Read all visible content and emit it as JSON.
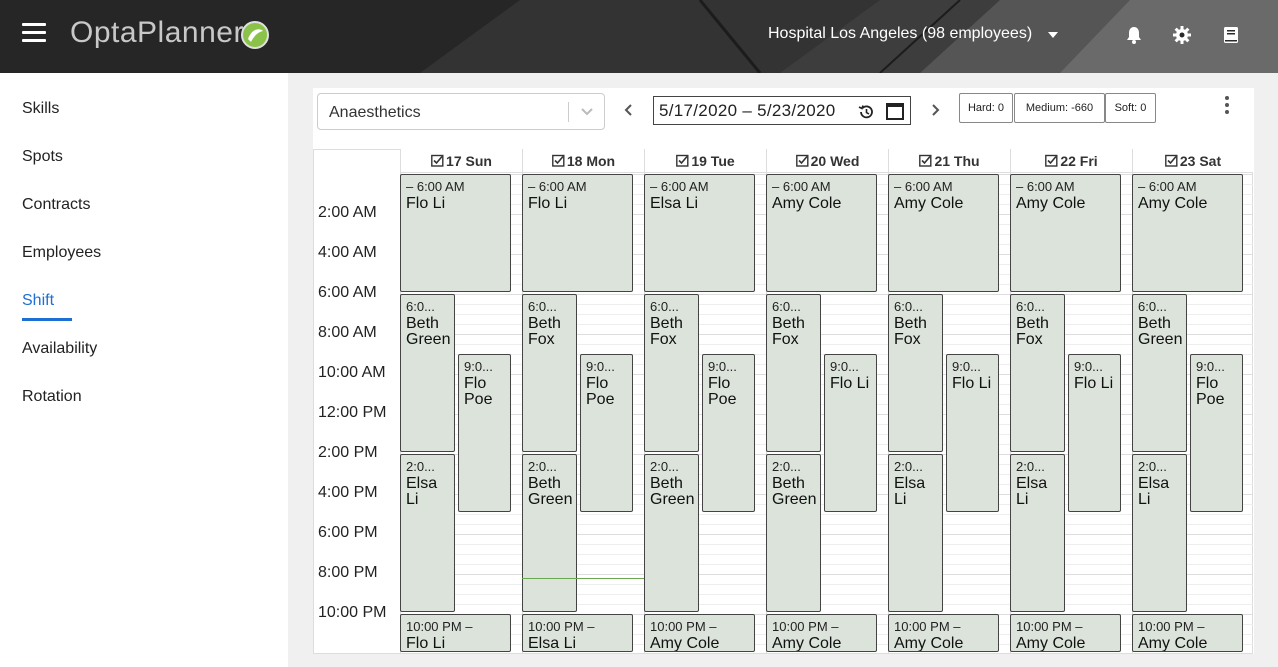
{
  "header": {
    "brand": "OptaPlanner",
    "tenant": "Hospital Los Angeles (98 employees)",
    "icons": [
      "bell-icon",
      "gear-icon",
      "book-icon"
    ]
  },
  "sidebar": {
    "items": [
      {
        "label": "Skills",
        "active": false
      },
      {
        "label": "Spots",
        "active": false
      },
      {
        "label": "Contracts",
        "active": false
      },
      {
        "label": "Employees",
        "active": false
      },
      {
        "label": "Shift",
        "active": true
      },
      {
        "label": "Availability",
        "active": false
      },
      {
        "label": "Rotation",
        "active": false
      }
    ],
    "accent_color": "#1d6fd1"
  },
  "toolbar": {
    "spot": "Anaesthetics",
    "date_range": "5/17/2020 – 5/23/2020",
    "hard": "Hard: 0",
    "medium": "Medium: -660",
    "soft": "Soft: 0"
  },
  "calendar": {
    "days": [
      "17 Sun",
      "18 Mon",
      "19 Tue",
      "20 Wed",
      "21 Thu",
      "22 Fri",
      "23 Sat"
    ],
    "times": [
      "2:00 AM",
      "4:00 AM",
      "6:00 AM",
      "8:00 AM",
      "10:00 AM",
      "12:00 PM",
      "2:00 PM",
      "4:00 PM",
      "6:00 PM",
      "8:00 PM",
      "10:00 PM"
    ],
    "shift_color": "#dbe3db",
    "shifts": [
      {
        "time": "– 6:00 AM",
        "who": "Flo Li"
      },
      {
        "time": "– 6:00 AM",
        "who": "Flo Li"
      },
      {
        "time": "– 6:00 AM",
        "who": "Elsa Li"
      },
      {
        "time": "– 6:00 AM",
        "who": "Amy Cole"
      },
      {
        "time": "– 6:00 AM",
        "who": "Amy Cole"
      },
      {
        "time": "– 6:00 AM",
        "who": "Amy Cole"
      },
      {
        "time": "– 6:00 AM",
        "who": "Amy Cole"
      },
      {
        "time": "6:0...",
        "who": "Beth Green"
      },
      {
        "time": "6:0...",
        "who": "Beth Fox"
      },
      {
        "time": "6:0...",
        "who": "Beth Fox"
      },
      {
        "time": "6:0...",
        "who": "Beth Fox"
      },
      {
        "time": "6:0...",
        "who": "Beth Fox"
      },
      {
        "time": "6:0...",
        "who": "Beth Fox"
      },
      {
        "time": "6:0...",
        "who": "Beth Green"
      },
      {
        "time": "9:0...",
        "who": "Flo Poe"
      },
      {
        "time": "9:0...",
        "who": "Flo Poe"
      },
      {
        "time": "9:0...",
        "who": "Flo Poe"
      },
      {
        "time": "9:0...",
        "who": "Flo Li"
      },
      {
        "time": "9:0...",
        "who": "Flo Li"
      },
      {
        "time": "9:0...",
        "who": "Flo Li"
      },
      {
        "time": "9:0...",
        "who": "Flo Poe"
      },
      {
        "time": "2:0...",
        "who": "Elsa Li"
      },
      {
        "time": "2:0...",
        "who": "Beth Green"
      },
      {
        "time": "2:0...",
        "who": "Beth Green"
      },
      {
        "time": "2:0...",
        "who": "Beth Green"
      },
      {
        "time": "2:0...",
        "who": "Elsa Li"
      },
      {
        "time": "2:0...",
        "who": "Elsa Li"
      },
      {
        "time": "2:0...",
        "who": "Elsa Li"
      },
      {
        "time": "10:00 PM –",
        "who": "Flo Li"
      },
      {
        "time": "10:00 PM –",
        "who": "Elsa Li"
      },
      {
        "time": "10:00 PM –",
        "who": "Amy Cole"
      },
      {
        "time": "10:00 PM –",
        "who": "Amy Cole"
      },
      {
        "time": "10:00 PM –",
        "who": "Amy Cole"
      },
      {
        "time": "10:00 PM –",
        "who": "Amy Cole"
      },
      {
        "time": "10:00 PM –",
        "who": "Amy Cole"
      }
    ]
  }
}
